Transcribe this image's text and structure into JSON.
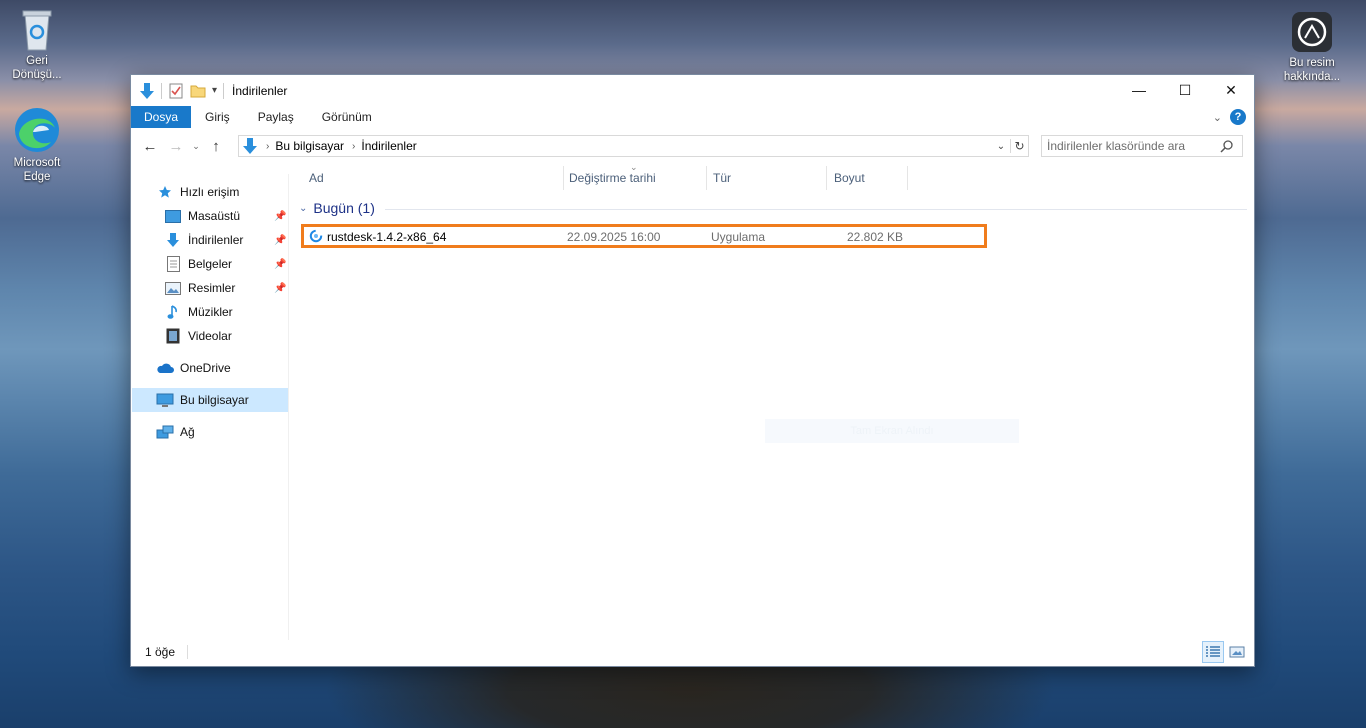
{
  "desktop": {
    "recycle_bin_label": "Geri Dönüşü...",
    "edge_label": "Microsoft Edge",
    "image_info_label": "Bu resim hakkında..."
  },
  "window": {
    "title": "İndirilenler",
    "controls": {
      "minimize": "—",
      "maximize": "☐",
      "close": "✕"
    }
  },
  "ribbon": {
    "tabs": [
      {
        "label": "Dosya"
      },
      {
        "label": "Giriş"
      },
      {
        "label": "Paylaş"
      },
      {
        "label": "Görünüm"
      }
    ],
    "help": "?"
  },
  "address": {
    "crumbs": [
      "Bu bilgisayar",
      "İndirilenler"
    ],
    "search_placeholder": "İndirilenler klasöründe ara"
  },
  "sidebar": {
    "items": [
      {
        "label": "Hızlı erişim",
        "icon": "star-icon"
      },
      {
        "label": "Masaüstü",
        "icon": "desktop-folder-icon",
        "pinned": true
      },
      {
        "label": "İndirilenler",
        "icon": "download-icon",
        "pinned": true
      },
      {
        "label": "Belgeler",
        "icon": "document-icon",
        "pinned": true
      },
      {
        "label": "Resimler",
        "icon": "pictures-icon",
        "pinned": true
      },
      {
        "label": "Müzikler",
        "icon": "music-icon"
      },
      {
        "label": "Videolar",
        "icon": "video-icon"
      },
      {
        "label": "OneDrive",
        "icon": "cloud-icon"
      },
      {
        "label": "Bu bilgisayar",
        "icon": "computer-icon",
        "selected": true
      },
      {
        "label": "Ağ",
        "icon": "network-icon"
      }
    ]
  },
  "columns": [
    "Ad",
    "Değiştirme tarihi",
    "Tür",
    "Boyut"
  ],
  "group": {
    "label": "Bugün (1)"
  },
  "files": [
    {
      "name": "rustdesk-1.4.2-x86_64",
      "modified": "22.09.2025 16:00",
      "type": "Uygulama",
      "size": "22.802 KB"
    }
  ],
  "ghost_text": "Tam Ekran Alındı",
  "status": {
    "count": "1 öğe"
  },
  "colors": {
    "accent": "#1979ca",
    "highlight": "#f07c1c",
    "group_text": "#1e3287",
    "selected": "#cce8ff"
  }
}
